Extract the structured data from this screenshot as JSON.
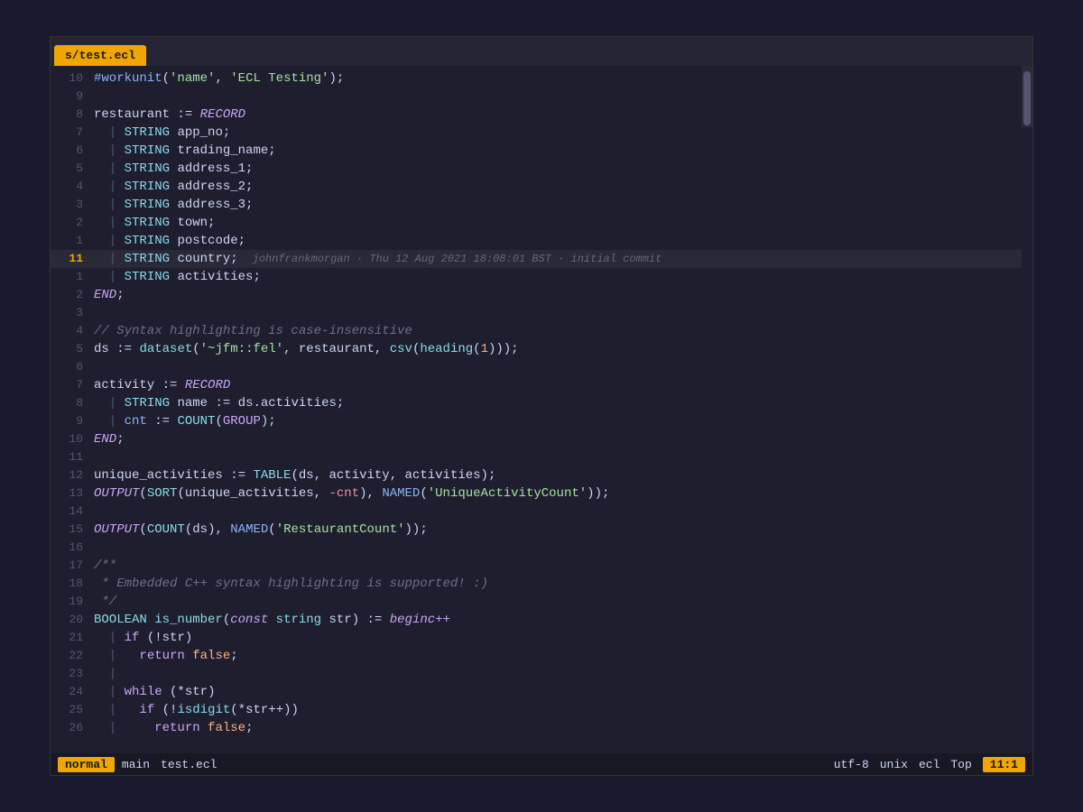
{
  "tab": {
    "label": "s/test.ecl"
  },
  "status": {
    "mode": "normal",
    "branch": "main",
    "file": "test.ecl",
    "encoding": "utf-8",
    "os": "unix",
    "lang": "ecl",
    "scroll": "Top",
    "position": "11:1"
  },
  "lines": [
    {
      "num": "10",
      "content": "#workunit('name', 'ECL Testing');"
    },
    {
      "num": "9",
      "content": ""
    },
    {
      "num": "8",
      "content": "restaurant := RECORD"
    },
    {
      "num": "7",
      "content": "  STRING app_no;"
    },
    {
      "num": "6",
      "content": "  STRING trading_name;"
    },
    {
      "num": "5",
      "content": "  STRING address_1;"
    },
    {
      "num": "4",
      "content": "  STRING address_2;"
    },
    {
      "num": "3",
      "content": "  STRING address_3;"
    },
    {
      "num": "2",
      "content": "  STRING town;"
    },
    {
      "num": "1",
      "content": "  STRING postcode;"
    },
    {
      "num": "11",
      "content": "  STRING country;",
      "current": true,
      "blame": "johnfrankmorgan · Thu 12 Aug 2021 18:08:01 BST · initial commit"
    },
    {
      "num": "1",
      "content": "  STRING activities;"
    },
    {
      "num": "2",
      "content": "END;"
    },
    {
      "num": "3",
      "content": ""
    },
    {
      "num": "4",
      "content": "// Syntax highlighting is case-insensitive"
    },
    {
      "num": "5",
      "content": "ds := dataset('~jfm::fel', restaurant, csv(heading(1)));"
    },
    {
      "num": "6",
      "content": ""
    },
    {
      "num": "7",
      "content": "activity := RECORD"
    },
    {
      "num": "8",
      "content": "  STRING name := ds.activities;"
    },
    {
      "num": "9",
      "content": "  cnt := COUNT(GROUP);"
    },
    {
      "num": "10",
      "content": "END;"
    },
    {
      "num": "11",
      "content": ""
    },
    {
      "num": "12",
      "content": "unique_activities := TABLE(ds, activity, activities);"
    },
    {
      "num": "13",
      "content": "OUTPUT(SORT(unique_activities, -cnt), NAMED('UniqueActivityCount'));"
    },
    {
      "num": "14",
      "content": ""
    },
    {
      "num": "15",
      "content": "OUTPUT(COUNT(ds), NAMED('RestaurantCount'));"
    },
    {
      "num": "16",
      "content": ""
    },
    {
      "num": "17",
      "content": "/**"
    },
    {
      "num": "18",
      "content": " * Embedded C++ syntax highlighting is supported! :)"
    },
    {
      "num": "19",
      "content": " */"
    },
    {
      "num": "20",
      "content": "BOOLEAN is_number(const string str) := beginc++"
    },
    {
      "num": "21",
      "content": "  if (!str)"
    },
    {
      "num": "22",
      "content": "    return false;"
    },
    {
      "num": "23",
      "content": "  |"
    },
    {
      "num": "24",
      "content": "  while (*str)"
    },
    {
      "num": "25",
      "content": "    if (!isdigit(*str++))"
    },
    {
      "num": "26",
      "content": "      return false;"
    }
  ]
}
